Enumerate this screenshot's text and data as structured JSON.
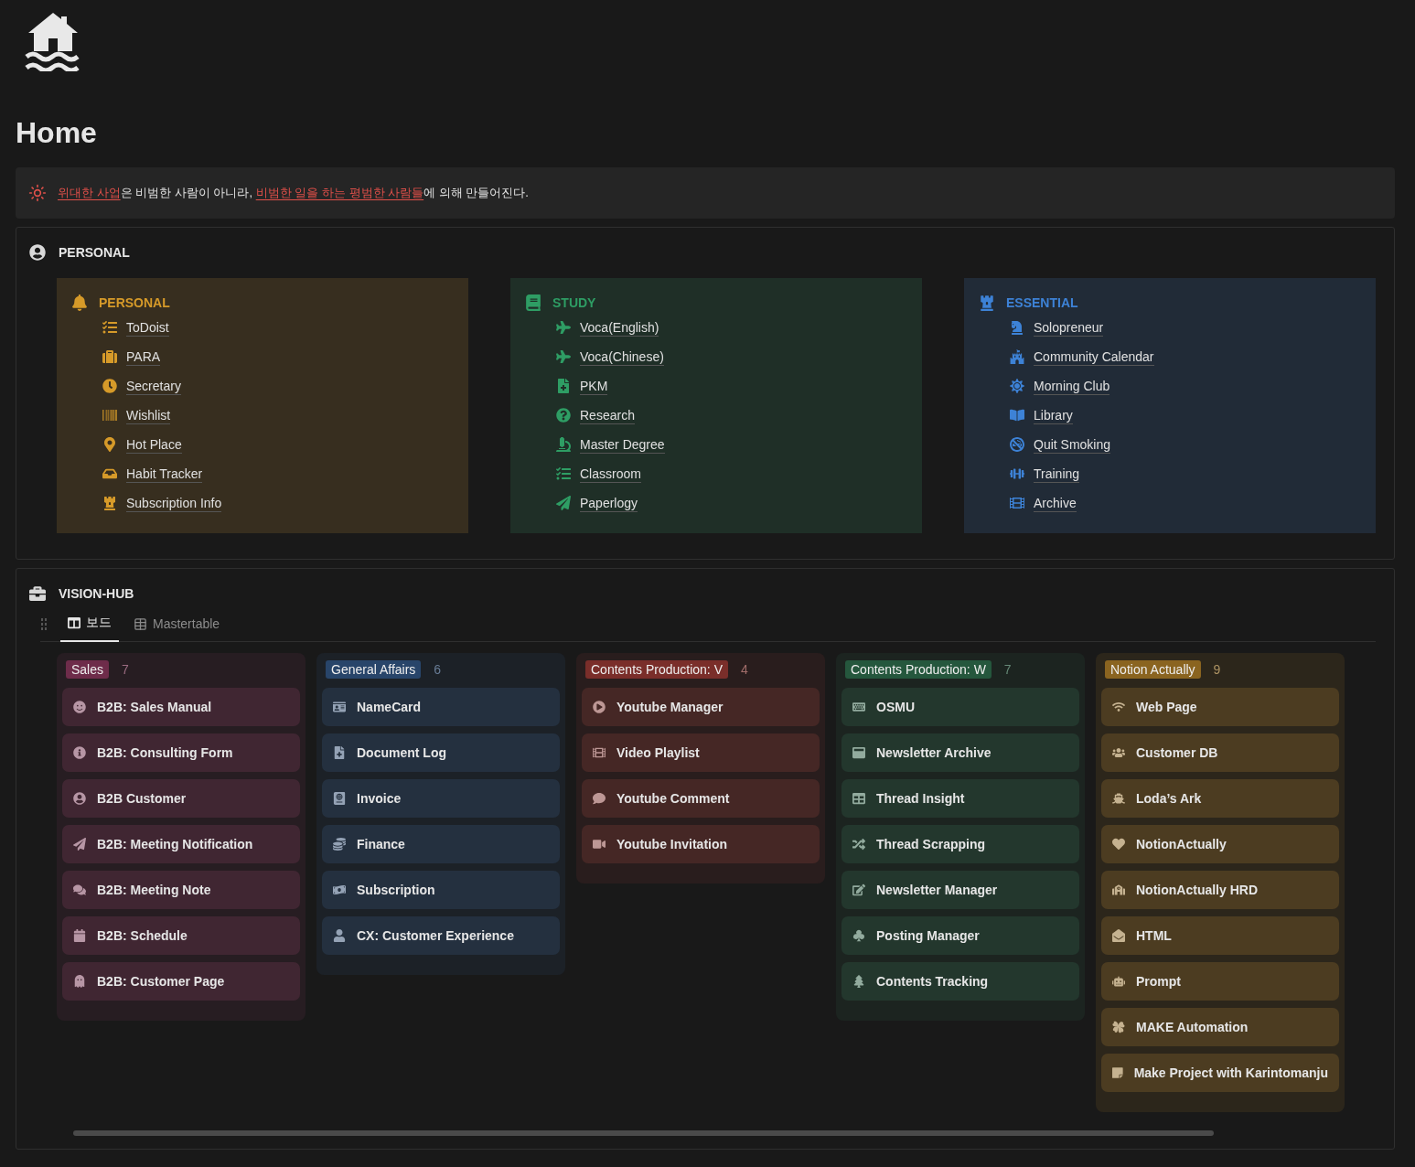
{
  "page": {
    "title": "Home"
  },
  "callout": {
    "segments": [
      {
        "text": "위대한 사업",
        "link": true
      },
      {
        "text": "은 비범한 사람이 아니라, ",
        "link": false
      },
      {
        "text": "비범한 일을 하는 평범한 사람들",
        "link": true
      },
      {
        "text": "에 의해 만들어진다.",
        "link": false
      }
    ]
  },
  "personal_section": {
    "title": "PERSONAL",
    "cards": [
      {
        "title": "PERSONAL",
        "color": "#d69a29",
        "items": [
          "ToDoist",
          "PARA",
          "Secretary",
          "Wishlist",
          "Hot Place",
          "Habit Tracker",
          "Subscription Info"
        ]
      },
      {
        "title": "STUDY",
        "color": "#2e9d64",
        "items": [
          "Voca(English)",
          "Voca(Chinese)",
          "PKM",
          "Research",
          "Master Degree",
          "Classroom",
          "Paperlogy"
        ]
      },
      {
        "title": "ESSENTIAL",
        "color": "#3d82d6",
        "items": [
          "Solopreneur",
          "Community Calendar",
          "Morning Club",
          "Library",
          "Quit Smoking",
          "Training",
          "Archive"
        ]
      }
    ]
  },
  "vision_hub": {
    "title": "VISION-HUB",
    "tabs": [
      {
        "label": "보드",
        "selected": true
      },
      {
        "label": "Mastertable",
        "selected": false
      }
    ],
    "columns": [
      {
        "tag": "Sales",
        "count": "7",
        "color": "#6e2c4a",
        "cards": [
          "B2B: Sales Manual",
          "B2B: Consulting Form",
          "B2B Customer",
          "B2B: Meeting Notification",
          "B2B: Meeting Note",
          "B2B: Schedule",
          "B2B: Customer Page"
        ]
      },
      {
        "tag": "General Affairs",
        "count": "6",
        "color": "#28456a",
        "cards": [
          "NameCard",
          "Document Log",
          "Invoice",
          "Finance",
          "Subscription",
          "CX: Customer Experience"
        ]
      },
      {
        "tag": "Contents Production: V",
        "count": "4",
        "color": "#7a2e2a",
        "cards": [
          "Youtube Manager",
          "Video Playlist",
          "Youtube Comment",
          "Youtube Invitation"
        ]
      },
      {
        "tag": "Contents Production: W",
        "count": "7",
        "color": "#25573d",
        "cards": [
          "OSMU",
          "Newsletter Archive",
          "Thread Insight",
          "Thread Scrapping",
          "Newsletter Manager",
          "Posting Manager",
          "Contents Tracking"
        ]
      },
      {
        "tag": "Notion Actually",
        "count": "9",
        "color": "#8a6420",
        "cards": [
          "Web Page",
          "Customer DB",
          "Loda’s Ark",
          "NotionActually",
          "NotionActually HRD",
          "HTML",
          "Prompt",
          "MAKE Automation",
          "Make Project with Karintomanju"
        ]
      }
    ]
  }
}
